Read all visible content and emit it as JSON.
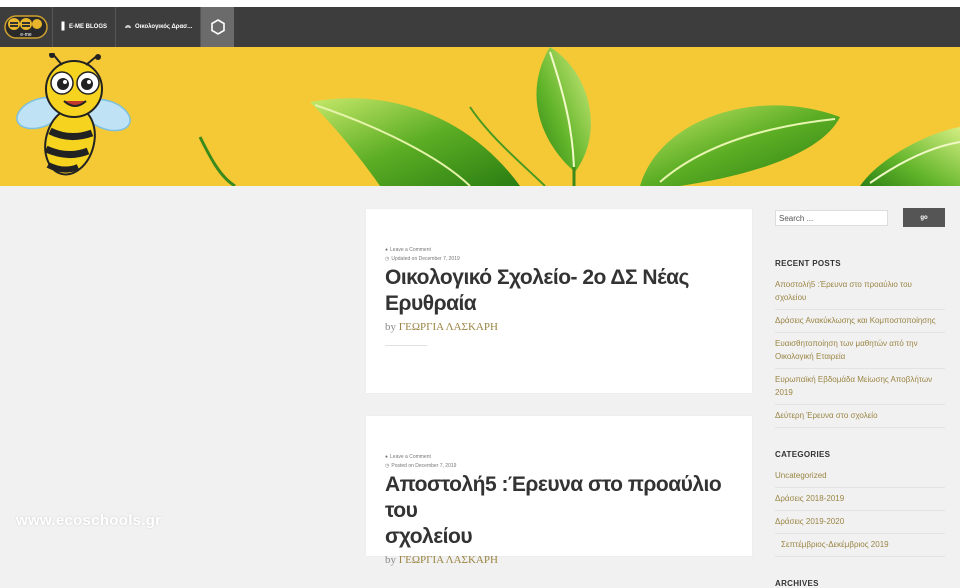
{
  "nav": {
    "items": [
      {
        "label": "E-ME BLOGS",
        "icon": "file-icon"
      },
      {
        "label": "Οικολογικός Δρασ...",
        "icon": "dashboard-icon"
      }
    ],
    "logo_text": "e-me"
  },
  "posts": [
    {
      "comment_label": "Leave a Comment",
      "date_label": "Updated on December 7, 2019",
      "title_line1": "Οικολογικό Σχολείο- 2ο ΔΣ Νέας",
      "title_line2": "Ερυθραία",
      "by": "by",
      "author": "ΓΕΩΡΓΙΑ ΛΑΣΚΑΡΗ"
    },
    {
      "comment_label": "Leave a Comment",
      "date_label": "Posted on December 7, 2019",
      "title_line1": "Αποστολή5 :Έρευνα στο προαύλιο του",
      "title_line2": "σχολείου",
      "by": "by",
      "author": "ΓΕΩΡΓΙΑ ΛΑΣΚΑΡΗ"
    }
  ],
  "sidebar": {
    "search_placeholder": "Search ...",
    "search_button": "go",
    "recent_title": "RECENT POSTS",
    "recent": [
      "Αποστολή5 :Έρευνα στο προαύλιο του σχολείου",
      "Δράσεις Ανακύκλωσης και Κομποστοποίησης",
      "Ευαισθητοποίηση των μαθητών από την Οικολογική Εταιρεία",
      "Ευρωπαϊκή Εβδομάδα Μείωσης Αποβλήτων 2019",
      "Δεύτερη Έρευνα στο σχολείο"
    ],
    "categories_title": "CATEGORIES",
    "categories": [
      "Uncategorized",
      "Δράσεις 2018-2019",
      "Δράσεις 2019-2020",
      "Σεπτέμβριος-Δεκέμβριος 2019"
    ],
    "archives_title": "ARCHIVES"
  },
  "watermark": "www.ecoschools.gr",
  "colors": {
    "banner": "#f5c935",
    "nav": "#3d3d3d",
    "link": "#9a8544"
  }
}
